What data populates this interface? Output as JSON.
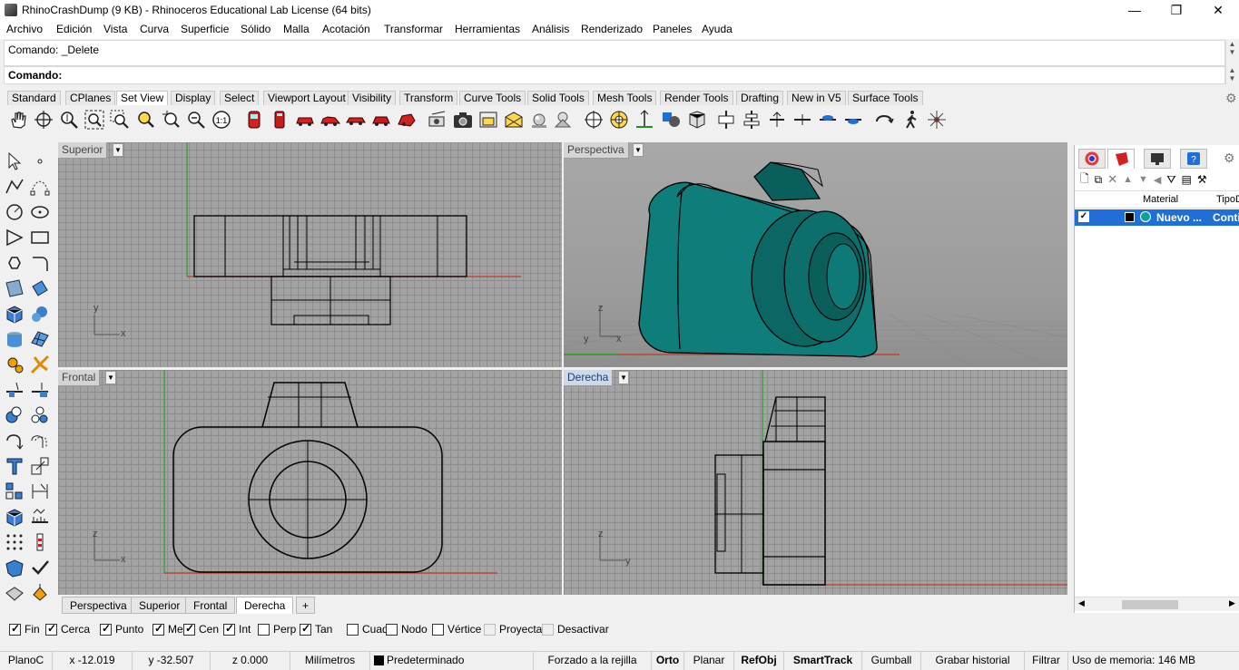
{
  "window": {
    "title": "RhinoCrashDump (9 KB) - Rhinoceros Educational Lab License (64 bits)",
    "minimize": "—",
    "restore": "❐",
    "close": "✕"
  },
  "menu": [
    "Archivo",
    "Edición",
    "Vista",
    "Curva",
    "Superficie",
    "Sólido",
    "Malla",
    "Acotación",
    "Transformar",
    "Herramientas",
    "Análisis",
    "Renderizado",
    "Paneles",
    "Ayuda"
  ],
  "command": {
    "history": "Comando: _Delete",
    "prompt": "Comando:"
  },
  "toolbar_tabs": [
    "Standard",
    "CPlanes",
    "Set View",
    "Display",
    "Select",
    "Viewport Layout",
    "Visibility",
    "Transform",
    "Curve Tools",
    "Solid Tools",
    "Mesh Tools",
    "Render Tools",
    "Drafting",
    "New in V5",
    "Surface Tools"
  ],
  "active_toolbar_tab": "Set View",
  "viewports": {
    "top": {
      "label": "Superior"
    },
    "persp": {
      "label": "Perspectiva"
    },
    "front": {
      "label": "Frontal"
    },
    "right": {
      "label": "Derecha"
    }
  },
  "axes": {
    "x": "x",
    "y": "y",
    "z": "z"
  },
  "viewport_tabs": [
    "Perspectiva",
    "Superior",
    "Frontal",
    "Derecha"
  ],
  "active_viewport_tab": "Derecha",
  "add_tab": "+",
  "osnaps": [
    {
      "label": "Fin",
      "checked": true
    },
    {
      "label": "Cerca",
      "checked": true
    },
    {
      "label": "Punto",
      "checked": true
    },
    {
      "label": "Med",
      "checked": true
    },
    {
      "label": "Cen",
      "checked": true
    },
    {
      "label": "Int",
      "checked": true
    },
    {
      "label": "Perp",
      "checked": false
    },
    {
      "label": "Tan",
      "checked": true
    },
    {
      "label": "Cuad",
      "checked": false
    },
    {
      "label": "Nodo",
      "checked": false
    },
    {
      "label": "Vértice",
      "checked": false
    },
    {
      "label": "Proyectar",
      "checked": false
    },
    {
      "label": "Desactivar",
      "checked": false
    }
  ],
  "status": {
    "cplane": "PlanoC",
    "x": "x -12.019",
    "y": "y -32.507",
    "z": "z 0.000",
    "units": "Milímetros",
    "layer": "Predeterminado",
    "grid_snap": "Forzado a la rejilla",
    "ortho": "Orto",
    "planar": "Planar",
    "osnap": "RefObj",
    "smarttrack": "SmartTrack",
    "gumball": "Gumball",
    "history": "Grabar historial",
    "filter": "Filtrar",
    "memory": "Uso de memoria: 146 MB"
  },
  "materials_panel": {
    "col_material": "Material",
    "col_type": "TipoD",
    "row_name": "Nuevo ...",
    "row_type": "Conti"
  },
  "colors": {
    "accent": "#1f6fd6",
    "teal": "#0f7e7b",
    "teal_dark": "#0a5f5c",
    "axis_x": "#c0392b",
    "axis_y": "#2e9e2e"
  }
}
